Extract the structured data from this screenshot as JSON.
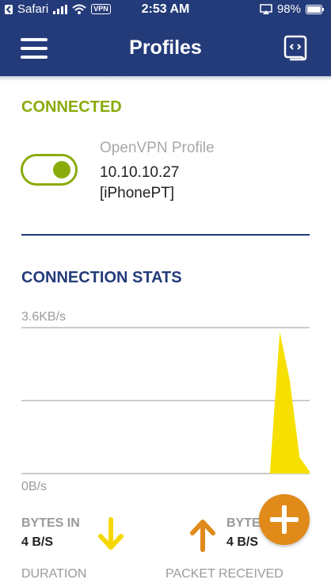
{
  "status_bar": {
    "back_app": "Safari",
    "time": "2:53 AM",
    "vpn": "VPN",
    "battery": "98%"
  },
  "navbar": {
    "title": "Profiles"
  },
  "connection": {
    "status": "CONNECTED",
    "toggle_on": true,
    "profile_name": "OpenVPN Profile",
    "address": "10.10.10.27",
    "user": "[iPhonePT]"
  },
  "stats": {
    "title": "CONNECTION STATS",
    "bytes_in_label": "BYTES IN",
    "bytes_in_value": "4 B/S",
    "bytes_out_label": "BYTE",
    "bytes_out_value": "4 B/S",
    "duration_label": "DURATION",
    "packet_label": "PACKET RECEIVED"
  },
  "chart_data": {
    "type": "area",
    "ymax_label": "3.6KB/s",
    "ymin_label": "0B/s",
    "ylim": [
      0,
      3.6
    ],
    "x": [
      0,
      1,
      2,
      3,
      4,
      5,
      6,
      7,
      8,
      9,
      10,
      11,
      12,
      13,
      14,
      15,
      16,
      17,
      18,
      19,
      20,
      21,
      22,
      23,
      24,
      25,
      26,
      27,
      28,
      29
    ],
    "series": [
      {
        "color": "#f5e000",
        "values": [
          0,
          0,
          0,
          0,
          0,
          0,
          0,
          0,
          0,
          0,
          0,
          0,
          0,
          0,
          0,
          0,
          0,
          0,
          0,
          0,
          0,
          0,
          0,
          0,
          0,
          0,
          3.5,
          2.3,
          0.4,
          0.05
        ]
      }
    ]
  },
  "colors": {
    "navy": "#243b7a",
    "green": "#8aab0c",
    "orange": "#e08a1a",
    "yellow": "#f5d800"
  }
}
